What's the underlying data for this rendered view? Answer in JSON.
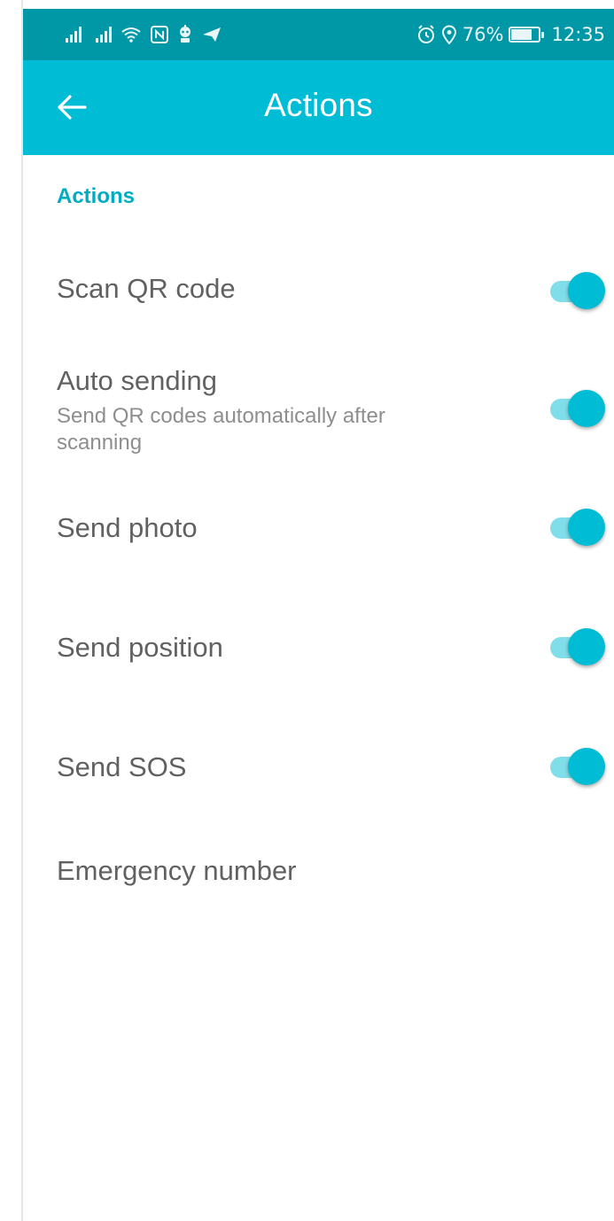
{
  "status_bar": {
    "battery_percent": "76%",
    "time": "12:35",
    "icons_left": [
      "signal-icon",
      "signal-icon",
      "wifi-icon",
      "nfc-icon",
      "android-bot-icon",
      "send-icon"
    ],
    "icons_right": [
      "alarm-icon",
      "location-icon",
      "battery-icon"
    ]
  },
  "app_bar": {
    "title": "Actions",
    "back_icon": "arrow-left-icon"
  },
  "section": {
    "header": "Actions"
  },
  "settings": [
    {
      "title": "Scan QR code",
      "subtitle": "",
      "toggle": true
    },
    {
      "title": "Auto sending",
      "subtitle": "Send QR codes automatically after scanning",
      "toggle": true
    },
    {
      "title": "Send photo",
      "subtitle": "",
      "toggle": true
    },
    {
      "title": "Send position",
      "subtitle": "",
      "toggle": true
    },
    {
      "title": "Send SOS",
      "subtitle": "",
      "toggle": true
    },
    {
      "title": "Emergency number",
      "subtitle": ""
    }
  ],
  "colors": {
    "status_bar": "#0097a7",
    "app_bar": "#00bcd4",
    "accent": "#00bcd4",
    "toggle_track": "#80deea",
    "section_header": "#00acc1"
  }
}
